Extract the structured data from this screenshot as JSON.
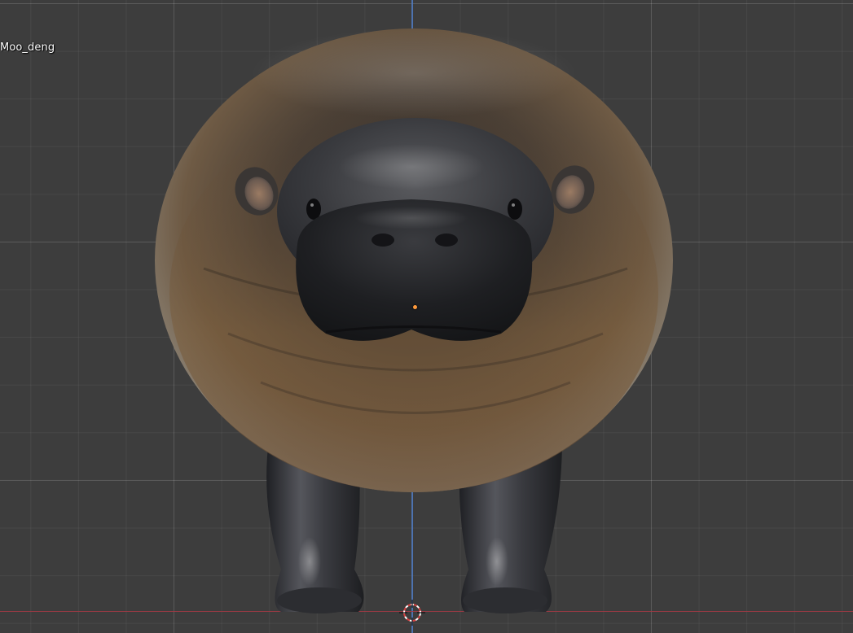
{
  "viewport": {
    "object_name": "Moo_deng"
  },
  "colors": {
    "background": "#3d3d3d",
    "axis_y": "#4e79c0",
    "axis_x": "#a23a44",
    "origin": "#ff9a3c",
    "model_dark": "#2a2b2e",
    "model_warm": "#7a5c3a"
  },
  "icons": {
    "cursor": "3d-cursor-icon",
    "origin": "object-origin-icon"
  }
}
